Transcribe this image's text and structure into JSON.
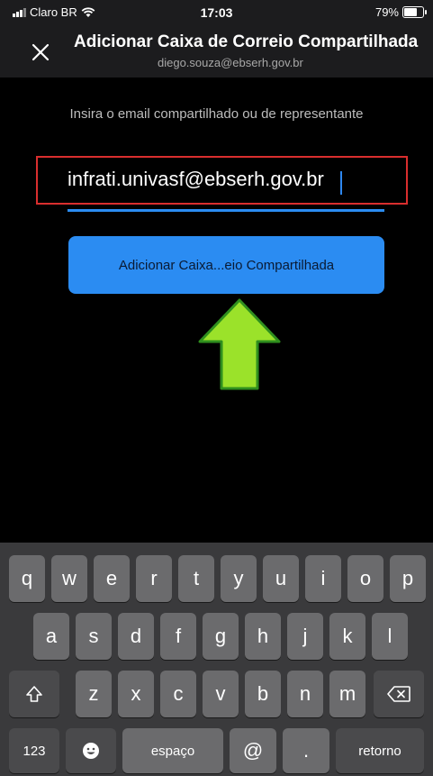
{
  "status_bar": {
    "carrier": "Claro BR",
    "time": "17:03",
    "battery": "79%",
    "battery_level": 0.79
  },
  "header": {
    "title": "Adicionar Caixa de Correio Compartilhada",
    "subtitle": "diego.souza@ebserh.gov.br",
    "close_icon": "close-icon"
  },
  "form": {
    "prompt": "Insira o email compartilhado ou de representante",
    "email_value": "infrati.univasf@ebserh.gov.br",
    "button_label": "Adicionar Caixa...eio Compartilhada"
  },
  "annotation": {
    "highlight_color": "#d92e2e",
    "arrow_color": "#9be22a"
  },
  "keyboard": {
    "row1": [
      "q",
      "w",
      "e",
      "r",
      "t",
      "y",
      "u",
      "i",
      "o",
      "p"
    ],
    "row2": [
      "a",
      "s",
      "d",
      "f",
      "g",
      "h",
      "j",
      "k",
      "l"
    ],
    "row3": [
      "z",
      "x",
      "c",
      "v",
      "b",
      "n",
      "m"
    ],
    "numbers_label": "123",
    "space_label": "espaço",
    "at_label": "@",
    "dot_label": ".",
    "return_label": "retorno",
    "shift_icon": "shift-icon",
    "delete_icon": "backspace-icon",
    "emoji_icon": "emoji-icon"
  }
}
